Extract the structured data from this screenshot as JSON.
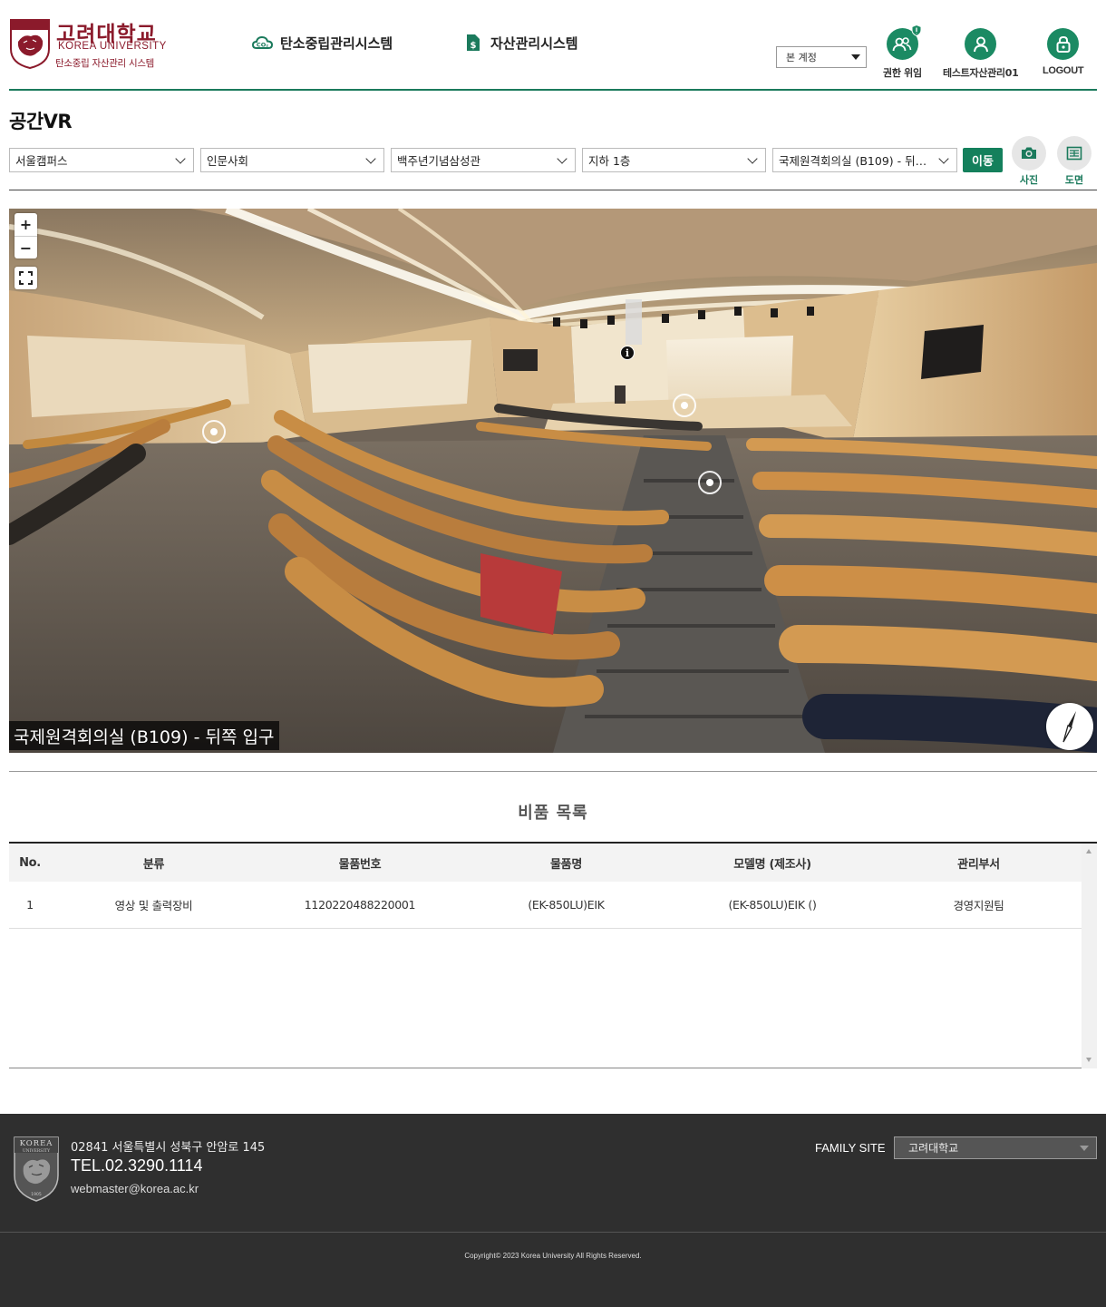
{
  "brand": {
    "title_ko": "고려대학교",
    "title_en": "KOREA UNIVERSITY",
    "subtitle": "탄소중립 자산관리 시스템",
    "crest_top": "KOREA",
    "crest_sub": "UNIVERSITY",
    "crest_year": "1905",
    "color": "#8b1a2b"
  },
  "topnav": [
    {
      "label": "탄소중립관리시스템",
      "icon": "co2-cloud-icon"
    },
    {
      "label": "자산관리시스템",
      "icon": "dollar-document-icon"
    }
  ],
  "account_select": {
    "value": "본 계정"
  },
  "util_menu": [
    {
      "label": "권한 위임",
      "icon": "delegate-users-icon"
    },
    {
      "label": "테스트자산관리01",
      "icon": "user-icon"
    },
    {
      "label": "LOGOUT",
      "icon": "lock-icon"
    }
  ],
  "page_title": "공간VR",
  "filters": {
    "campus": "서울캠퍼스",
    "area": "인문사회",
    "building": "백주년기념삼성관",
    "floor": "지하 1층",
    "room": "국제원격회의실 (B109) - 뒤쪽 입구",
    "go_button": "이동",
    "photo_label": "사진",
    "plan_label": "도면"
  },
  "viewer": {
    "zoom_in": "+",
    "zoom_out": "−",
    "caption": "국제원격회의실 (B109) - 뒤쪽 입구",
    "info_glyph": "i"
  },
  "items": {
    "title": "비품 목록",
    "columns": [
      "No.",
      "분류",
      "물품번호",
      "물품명",
      "모델명 (제조사)",
      "관리부서"
    ],
    "rows": [
      [
        "1",
        "영상 및 출력장비",
        "1120220488220001",
        "(EK-850LU)EIK",
        "(EK-850LU)EIK ()",
        "경영지원팀"
      ]
    ]
  },
  "footer": {
    "address": "02841 서울특별시 성북구 안암로 145",
    "tel": "TEL.02.3290.1114",
    "email": "webmaster@korea.ac.kr",
    "family_label": "FAMILY SITE",
    "family_value": "고려대학교",
    "copyright": "Copyright© 2023 Korea University All Rights Reserved."
  },
  "colors": {
    "accent": "#1b7a5c",
    "button": "#14805c",
    "footer_bg": "#2f2f2f"
  }
}
